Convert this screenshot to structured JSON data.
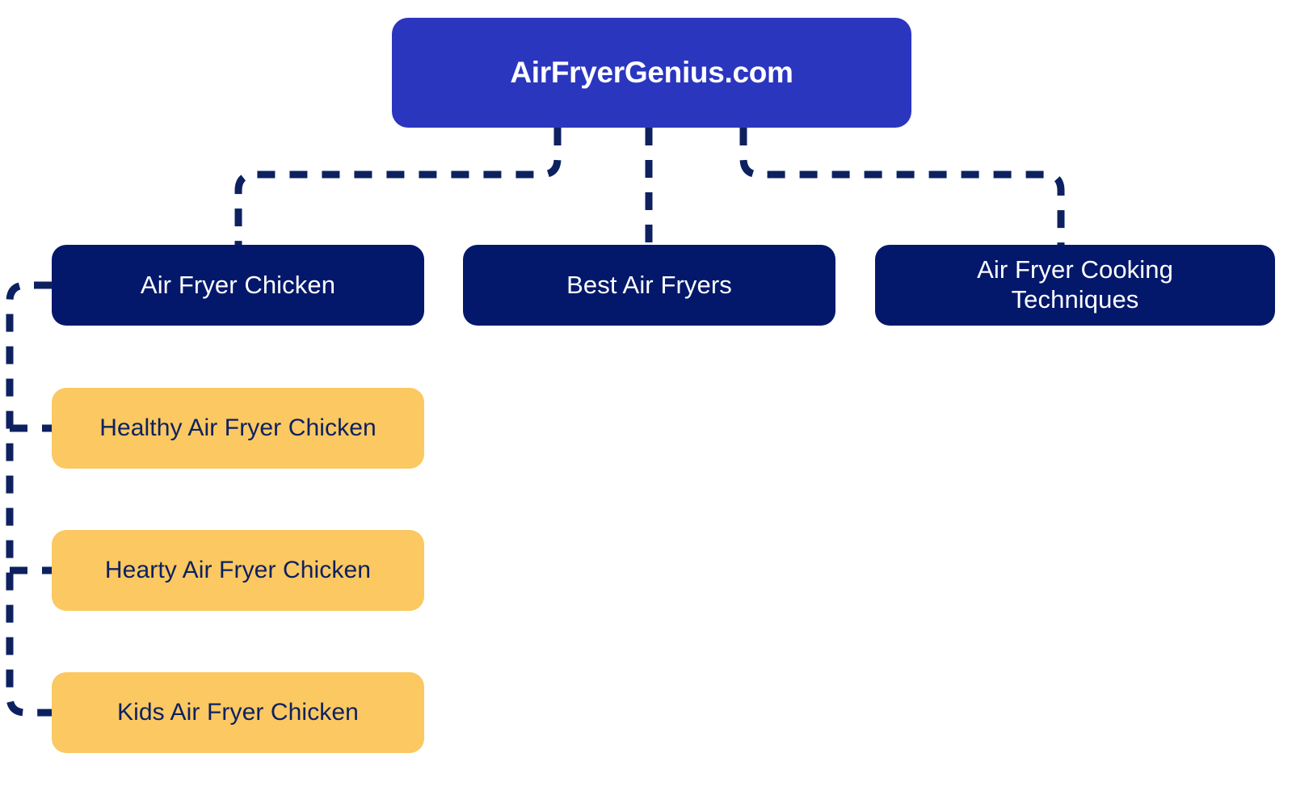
{
  "diagram": {
    "type": "site-structure-tree",
    "background_color": "#ffffff",
    "colors": {
      "root": "#2b36bf",
      "branch": "#04186b",
      "leaf": "#fbc861",
      "connector": "#0d2160",
      "root_text": "#ffffff",
      "branch_text": "#ffffff",
      "leaf_text": "#0d2160"
    },
    "root": {
      "label": "AirFryerGenius.com"
    },
    "branches": [
      {
        "label": "Air Fryer Chicken"
      },
      {
        "label": "Best Air Fryers"
      },
      {
        "label": "Air Fryer Cooking\nTechniques"
      }
    ],
    "leaves": [
      {
        "label": "Healthy Air Fryer Chicken"
      },
      {
        "label": "Hearty Air Fryer Chicken"
      },
      {
        "label": "Kids Air Fryer Chicken"
      }
    ]
  }
}
